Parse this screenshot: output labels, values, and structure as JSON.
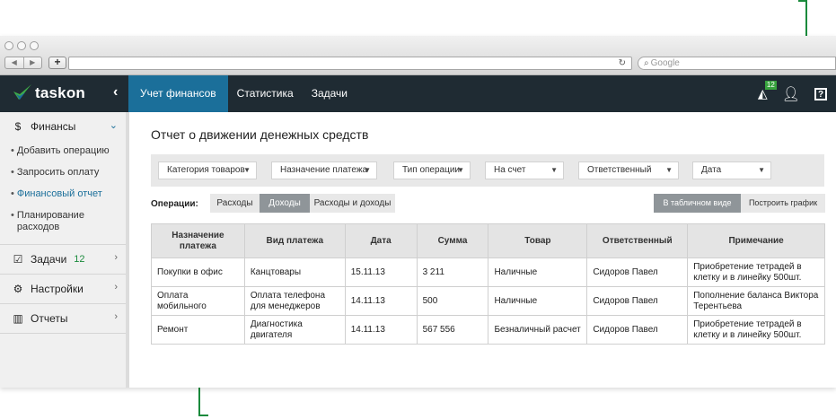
{
  "browser": {
    "search_placeholder": "Google"
  },
  "app": {
    "logo_text": "taskon",
    "nav": [
      {
        "label": "Учет финансов",
        "active": true
      },
      {
        "label": "Статистика",
        "active": false
      },
      {
        "label": "Задачи",
        "active": false
      }
    ],
    "notif_count": "12",
    "help_label": "?"
  },
  "sidebar": {
    "finance": {
      "label": "Финансы",
      "items": [
        {
          "label": "Добавить операцию",
          "active": false
        },
        {
          "label": "Запросить оплату",
          "active": false
        },
        {
          "label": "Финансовый отчет",
          "active": true
        },
        {
          "label": "Планирование расходов",
          "active": false
        }
      ]
    },
    "tasks": {
      "label": "Задачи",
      "count": "12"
    },
    "settings": {
      "label": "Настройки"
    },
    "reports": {
      "label": "Отчеты"
    }
  },
  "main": {
    "title": "Отчет о движении денежных средств",
    "filters": [
      "Категория товаров",
      "Назначение платежа",
      "Тип операции",
      "На счет",
      "Ответственный",
      "Дата"
    ],
    "operations_label": "Операции:",
    "op_tabs": [
      {
        "label": "Расходы",
        "active": false
      },
      {
        "label": "Доходы",
        "active": true
      },
      {
        "label": "Расходы и доходы",
        "active": false
      }
    ],
    "view_tabs": [
      {
        "label": "В табличном виде",
        "active": true
      },
      {
        "label": "Построить график",
        "active": false
      }
    ],
    "table": {
      "headers": [
        "Назначение платежа",
        "Вид платежа",
        "Дата",
        "Сумма",
        "Товар",
        "Ответственный",
        "Примечание"
      ],
      "rows": [
        [
          "Покупки в офис",
          "Канцтовары",
          "15.11.13",
          "3 211",
          "Наличные",
          "Сидоров Павел",
          "Приобретение тетрадей в клетку и в линейку 500шт."
        ],
        [
          "Оплата мобильного",
          "Оплата телефона для менеджеров",
          "14.11.13",
          "500",
          "Наличные",
          "Сидоров Павел",
          "Пополнение баланса Виктора Терентьева"
        ],
        [
          "Ремонт",
          "Диагностика двигателя",
          "14.11.13",
          "567 556",
          "Безналичный расчет",
          "Сидоров Павел",
          "Приобретение тетрадей в клетку и в линейку 500шт."
        ]
      ]
    }
  },
  "colors": {
    "accent": "#1b6f9a",
    "header_bg": "#1f2b33",
    "callout": "#1a8a3c"
  }
}
